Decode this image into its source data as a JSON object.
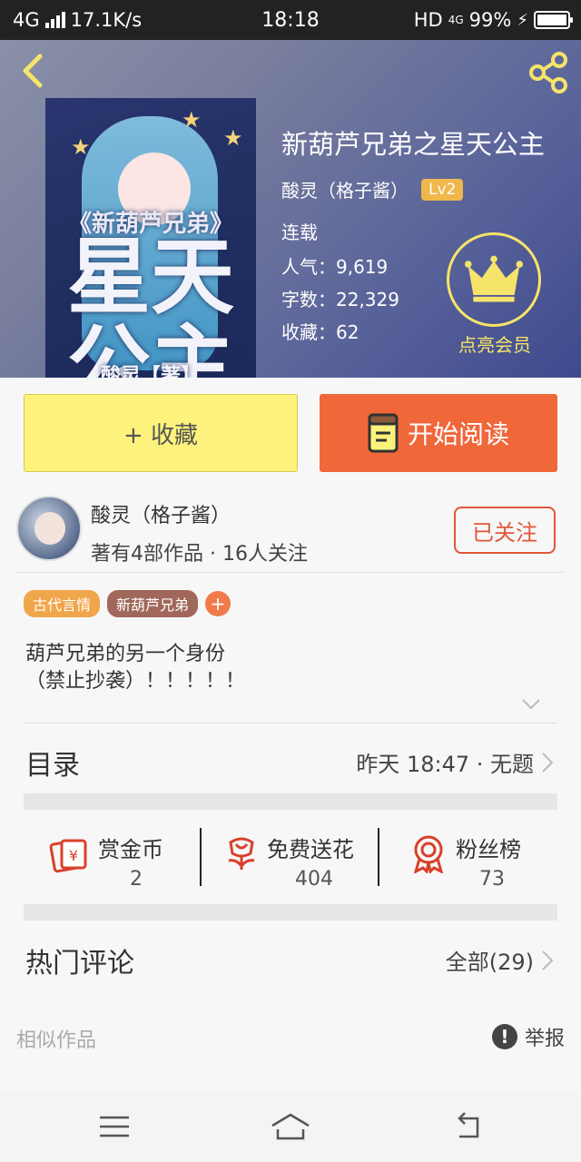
{
  "status_bar": {
    "network": "4G",
    "speed": "17.1K/s",
    "time": "18:18",
    "hd": "HD",
    "net2": "4G",
    "battery_text": "99%",
    "battery_level": 0.99
  },
  "book": {
    "cover_subtitle": "《新葫芦兄弟》",
    "cover_title": "星天公主",
    "cover_author": "酸灵【著】",
    "title": "新葫芦兄弟之星天公主",
    "author": "酸灵（格子酱）",
    "level": "Lv2",
    "status": "连载",
    "popularity": "人气：9,619",
    "word_count": "字数：22,329",
    "favorites": "收藏：62",
    "vip_label": "点亮会员"
  },
  "actions": {
    "collect": "+ 收藏",
    "read": "开始阅读"
  },
  "author_panel": {
    "name": "酸灵（格子酱）",
    "stats": "著有4部作品 · 16人关注",
    "follow": "已关注"
  },
  "tags": [
    "古代言情",
    "新葫芦兄弟"
  ],
  "tag_add": "+",
  "summary": {
    "line1": "葫芦兄弟的另一个身份",
    "line2": "（禁止抄袭）！！！！！"
  },
  "catalog": {
    "title": "目录",
    "latest": "昨天 18:47 · 无题"
  },
  "stats": [
    {
      "label": "赏金币",
      "value": "2",
      "icon": "red-envelope-icon"
    },
    {
      "label": "免费送花",
      "value": "404",
      "icon": "flower-icon"
    },
    {
      "label": "粉丝榜",
      "value": "73",
      "icon": "medal-icon"
    }
  ],
  "comments": {
    "title": "热门评论",
    "all": "全部(29)"
  },
  "footer": {
    "similar": "相似作品",
    "report": "举报",
    "report_icon": "!"
  },
  "colors": {
    "accent_orange": "#f0673a",
    "collect_yellow": "#fdf37c",
    "vip_yellow": "#f6e46a",
    "stat_red": "#d9402a"
  }
}
